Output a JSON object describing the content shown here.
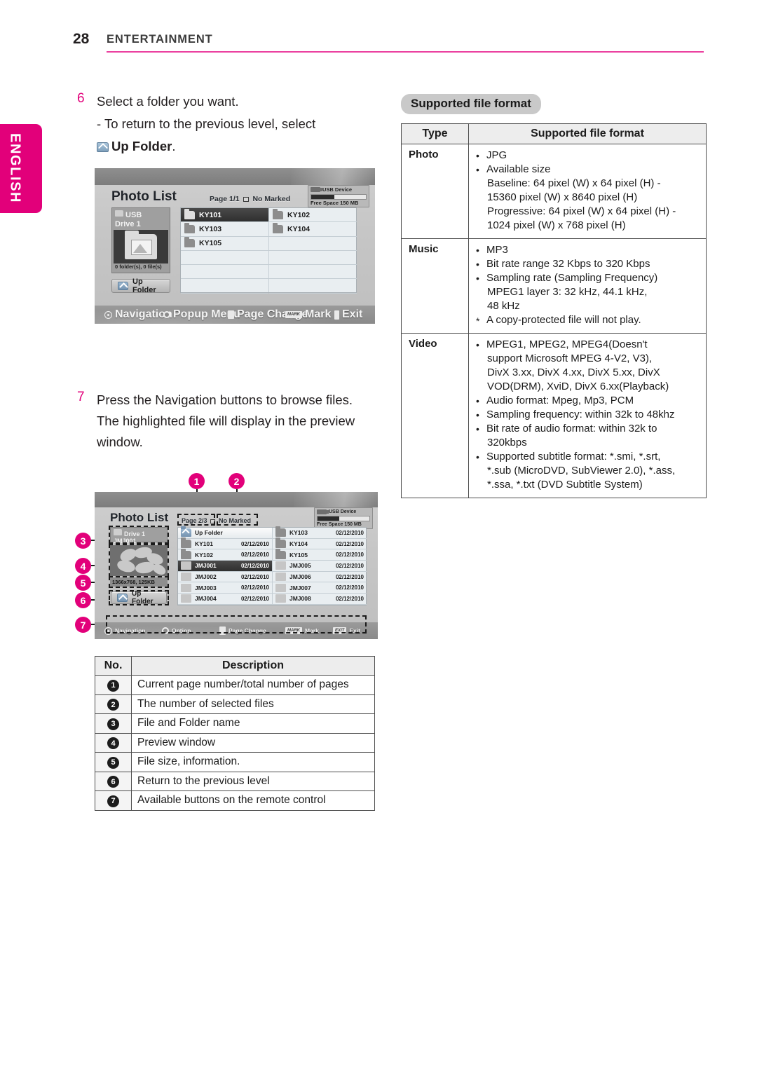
{
  "header": {
    "page_number": "28",
    "section": "ENTERTAINMENT",
    "language_tab": "ENGLISH"
  },
  "left": {
    "step6": {
      "number": "6",
      "line1": "Select a folder you want.",
      "line2": "- To return to the previous level, select",
      "up_folder_label": "Up Folder",
      "period": "."
    },
    "step7": {
      "number": "7",
      "line1": "Press the Navigation buttons to browse files.",
      "line2": "The highlighted file will display in the preview",
      "line3": "window."
    }
  },
  "screenshot1": {
    "title": "Photo List",
    "page_indicator": "Page 1/1",
    "marked_indicator": "No Marked",
    "usb_device": "USB Device",
    "free_space": "Free Space 150 MB",
    "drive_name_line1": "USB",
    "drive_name_line2": "Drive 1",
    "drive_meta": "0 folder(s), 0 file(s)",
    "up_folder": "Up Folder",
    "files": [
      {
        "name": "KY101",
        "type": "folder",
        "selected": true
      },
      {
        "name": "KY102",
        "type": "folder",
        "selected": false
      },
      {
        "name": "KY103",
        "type": "folder",
        "selected": false
      },
      {
        "name": "KY104",
        "type": "folder",
        "selected": false
      },
      {
        "name": "KY105",
        "type": "folder",
        "selected": false
      }
    ],
    "footer": [
      {
        "key": "navigation-icon",
        "label": "Navigation"
      },
      {
        "key": "popup-menu-icon",
        "label": "Popup Menu"
      },
      {
        "key": "page-change-icon",
        "label": "Page Change"
      },
      {
        "key": "mark-icon",
        "label": "Mark",
        "badge": "MARK"
      },
      {
        "key": "exit-icon",
        "label": "Exit"
      }
    ]
  },
  "screenshot2": {
    "title": "Photo List",
    "page_indicator": "Page 2/3",
    "marked_indicator": "No Marked",
    "usb_device": "USB Device",
    "free_space": "Free Space 150 MB",
    "drive_name_line1": "Drive 1",
    "drive_name_line2": "JMJ001",
    "file_info": "1366x768, 125KB",
    "up_folder": "Up Folder",
    "files_left": [
      {
        "name": "Up Folder",
        "date": "",
        "type": "up",
        "selected": false
      },
      {
        "name": "KY101",
        "date": "02/12/2010",
        "type": "folder",
        "selected": false
      },
      {
        "name": "KY102",
        "date": "02/12/2010",
        "type": "folder",
        "selected": false
      },
      {
        "name": "JMJ001",
        "date": "02/12/2010",
        "type": "file",
        "selected": true
      },
      {
        "name": "JMJ002",
        "date": "02/12/2010",
        "type": "file",
        "selected": false
      },
      {
        "name": "JMJ003",
        "date": "02/12/2010",
        "type": "file",
        "selected": false
      },
      {
        "name": "JMJ004",
        "date": "02/12/2010",
        "type": "file",
        "selected": false
      }
    ],
    "files_right": [
      {
        "name": "KY103",
        "date": "02/12/2010",
        "type": "folder",
        "selected": false
      },
      {
        "name": "KY104",
        "date": "02/12/2010",
        "type": "folder",
        "selected": false
      },
      {
        "name": "KY105",
        "date": "02/12/2010",
        "type": "folder",
        "selected": false
      },
      {
        "name": "JMJ005",
        "date": "02/12/2010",
        "type": "file",
        "selected": false
      },
      {
        "name": "JMJ006",
        "date": "02/12/2010",
        "type": "file",
        "selected": false
      },
      {
        "name": "JMJ007",
        "date": "02/12/2010",
        "type": "file",
        "selected": false
      },
      {
        "name": "JMJ008",
        "date": "02/12/2010",
        "type": "file",
        "selected": false
      }
    ],
    "footer": [
      {
        "key": "navigation-icon",
        "label": "Navigation"
      },
      {
        "key": "option-icon",
        "label": "Option"
      },
      {
        "key": "page-change-icon",
        "label": "Page Change"
      },
      {
        "key": "mark-icon",
        "label": "Mark",
        "badge": "MARK"
      },
      {
        "key": "exit-icon",
        "label": "Exit",
        "badge": "EXIT"
      }
    ],
    "callouts": [
      "1",
      "2",
      "3",
      "4",
      "5",
      "6",
      "7"
    ]
  },
  "desc_table": {
    "header_no": "No.",
    "header_desc": "Description",
    "rows": [
      {
        "no": "1",
        "desc": "Current page number/total number of pages"
      },
      {
        "no": "2",
        "desc": "The number of selected files"
      },
      {
        "no": "3",
        "desc": "File and Folder name"
      },
      {
        "no": "4",
        "desc": "Preview window"
      },
      {
        "no": "5",
        "desc": "File size, information."
      },
      {
        "no": "6",
        "desc": "Return to the previous level"
      },
      {
        "no": "7",
        "desc": "Available buttons on the remote control"
      }
    ]
  },
  "supported": {
    "pill_title": "Supported file format",
    "header_type": "Type",
    "header_format": "Supported file format",
    "rows": [
      {
        "type": "Photo",
        "items": [
          {
            "marker": "bullet",
            "text": "JPG",
            "cont": []
          },
          {
            "marker": "bullet",
            "text": "Available size",
            "cont": [
              "Baseline: 64 pixel (W) x 64 pixel (H) -",
              "15360 pixel (W) x 8640 pixel (H)",
              "Progressive: 64 pixel (W) x 64 pixel (H) -",
              "1024 pixel (W) x 768 pixel (H)"
            ]
          }
        ]
      },
      {
        "type": "Music",
        "items": [
          {
            "marker": "bullet",
            "text": "MP3",
            "cont": []
          },
          {
            "marker": "bullet",
            "text": "Bit rate range 32 Kbps to 320 Kbps",
            "cont": []
          },
          {
            "marker": "bullet",
            "text": "Sampling rate (Sampling Frequency)",
            "cont": [
              "MPEG1 layer 3: 32 kHz, 44.1 kHz,",
              "48 kHz"
            ]
          },
          {
            "marker": "star",
            "text": "A copy-protected file will not play.",
            "cont": []
          }
        ]
      },
      {
        "type": "Video",
        "items": [
          {
            "marker": "bullet",
            "text": "MPEG1, MPEG2, MPEG4(Doesn't",
            "cont": [
              "support Microsoft MPEG 4-V2, V3),",
              "DivX 3.xx, DivX 4.xx, DivX 5.xx, DivX",
              "VOD(DRM), XviD, DivX 6.xx(Playback)"
            ]
          },
          {
            "marker": "bullet",
            "text": "Audio format: Mpeg, Mp3, PCM",
            "cont": []
          },
          {
            "marker": "bullet",
            "text": "Sampling frequency: within 32k to 48khz",
            "cont": []
          },
          {
            "marker": "bullet",
            "text": "Bit rate of audio format: within 32k to",
            "cont": [
              "320kbps"
            ]
          },
          {
            "marker": "bullet",
            "text": "Supported subtitle format: *.smi, *.srt,",
            "cont": [
              "*.sub (MicroDVD, SubViewer 2.0), *.ass,",
              "*.ssa, *.txt (DVD Subtitle System)"
            ]
          }
        ]
      }
    ]
  }
}
